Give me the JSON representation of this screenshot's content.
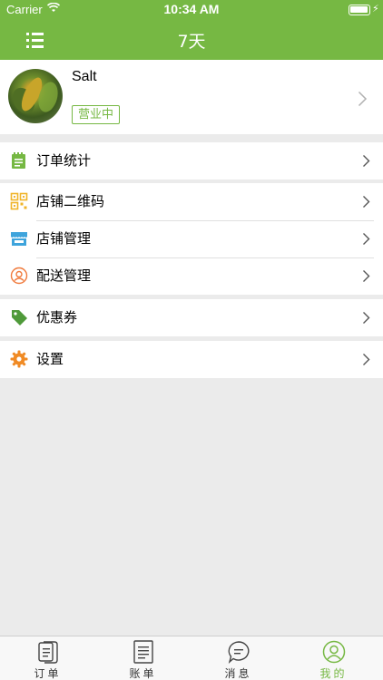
{
  "status_bar": {
    "carrier": "Carrier",
    "time": "10:34 AM"
  },
  "nav": {
    "title": "7天",
    "menu_icon": "list-menu-icon"
  },
  "profile": {
    "name": "Salt",
    "status": "营业中"
  },
  "menu": {
    "orders_stats": {
      "label": "订单统计",
      "icon": "notepad-icon"
    },
    "store_qrcode": {
      "label": "店铺二维码",
      "icon": "qrcode-icon"
    },
    "store_manage": {
      "label": "店铺管理",
      "icon": "storefront-icon"
    },
    "delivery_manage": {
      "label": "配送管理",
      "icon": "courier-icon"
    },
    "coupons": {
      "label": "优惠券",
      "icon": "tag-icon"
    },
    "settings": {
      "label": "设置",
      "icon": "gear-icon"
    }
  },
  "tabs": [
    {
      "label": "订单",
      "icon": "order-doc-icon",
      "active": false
    },
    {
      "label": "账单",
      "icon": "bill-icon",
      "active": false
    },
    {
      "label": "消息",
      "icon": "chat-bubble-icon",
      "active": false
    },
    {
      "label": "我的",
      "icon": "person-circle-icon",
      "active": true
    }
  ],
  "colors": {
    "accent": "#76b843",
    "background": "#ebebeb",
    "qrcode_icon": "#f0b429",
    "store_icon": "#3ea4dc",
    "courier_icon": "#f07a3c",
    "gear_icon": "#f08a24"
  }
}
